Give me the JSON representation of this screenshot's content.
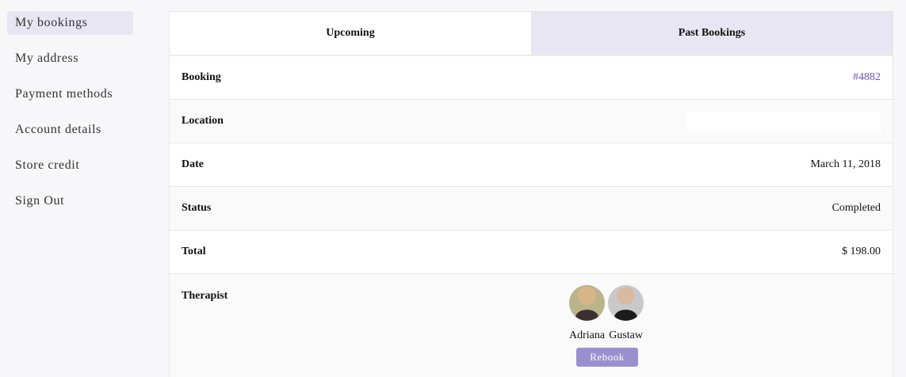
{
  "sidebar": {
    "items": [
      {
        "label": "My bookings",
        "active": true
      },
      {
        "label": "My address"
      },
      {
        "label": "Payment methods"
      },
      {
        "label": "Account details"
      },
      {
        "label": "Store credit"
      },
      {
        "label": "Sign Out"
      }
    ]
  },
  "tabs": {
    "upcoming": "Upcoming",
    "past": "Past Bookings",
    "selected": "Past Bookings"
  },
  "booking": {
    "booking_label": "Booking",
    "booking_value": "#4882",
    "location_label": "Location",
    "location_value": "",
    "date_label": "Date",
    "date_value": "March 11, 2018",
    "status_label": "Status",
    "status_value": "Completed",
    "total_label": "Total",
    "total_value": "$ 198.00",
    "therapist_label": "Therapist",
    "therapists": [
      {
        "name": "Adriana"
      },
      {
        "name": "Gustaw"
      }
    ],
    "rebook_label": "Rebook"
  },
  "colors": {
    "accent": "#6a4fc9",
    "button": "#9b90cf",
    "highlight": "#e8e6f2"
  }
}
